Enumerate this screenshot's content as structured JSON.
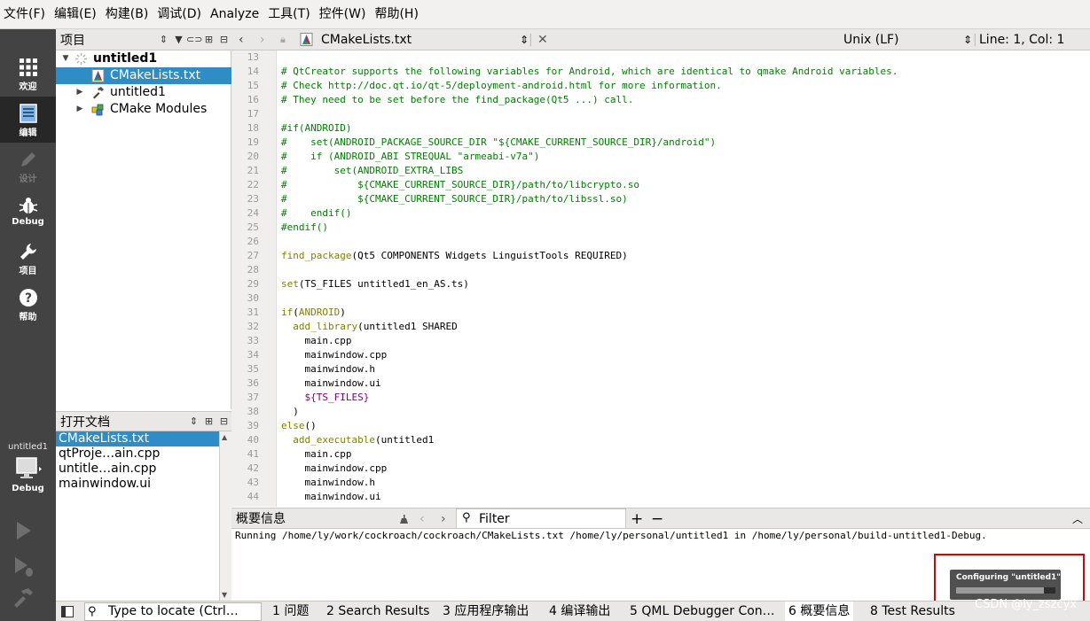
{
  "menu": [
    "文件(F)",
    "编辑(E)",
    "构建(B)",
    "调试(D)",
    "Analyze",
    "工具(T)",
    "控件(W)",
    "帮助(H)"
  ],
  "modes": [
    {
      "label": "欢迎",
      "icon": "grid-icon"
    },
    {
      "label": "编辑",
      "icon": "document-icon"
    },
    {
      "label": "设计",
      "icon": "pencil-icon"
    },
    {
      "label": "Debug",
      "icon": "bug-icon"
    },
    {
      "label": "项目",
      "icon": "wrench-icon"
    },
    {
      "label": "帮助",
      "icon": "help-icon"
    }
  ],
  "kit": {
    "name": "untitled1",
    "label": "Debug"
  },
  "project_panel": {
    "title": "项目",
    "tree": [
      {
        "label": "untitled1",
        "level": 0,
        "bold": true
      },
      {
        "label": "CMakeLists.txt",
        "level": 1,
        "selected": true
      },
      {
        "label": "untitled1",
        "level": 1
      },
      {
        "label": "CMake Modules",
        "level": 1
      }
    ]
  },
  "open_docs": {
    "title": "打开文档",
    "items": [
      "CMakeLists.txt",
      "qtProje…ain.cpp",
      "untitle…ain.cpp",
      "mainwindow.ui"
    ]
  },
  "editor_toolbar": {
    "file": "CMakeLists.txt",
    "line_ending": "Unix (LF)",
    "position": "Line: 1, Col: 1"
  },
  "code_lines": [
    {
      "n": "13",
      "t": ""
    },
    {
      "n": "14",
      "t": "# QtCreator supports the following variables for Android, which are identical to qmake Android variables."
    },
    {
      "n": "15",
      "t": "# Check http://doc.qt.io/qt-5/deployment-android.html for more information."
    },
    {
      "n": "16",
      "t": "# They need to be set before the find_package(Qt5 ...) call."
    },
    {
      "n": "17",
      "t": ""
    },
    {
      "n": "18",
      "t": "#if(ANDROID)"
    },
    {
      "n": "19",
      "t": "#    set(ANDROID_PACKAGE_SOURCE_DIR \"${CMAKE_CURRENT_SOURCE_DIR}/android\")"
    },
    {
      "n": "20",
      "t": "#    if (ANDROID_ABI STREQUAL \"armeabi-v7a\")"
    },
    {
      "n": "21",
      "t": "#        set(ANDROID_EXTRA_LIBS"
    },
    {
      "n": "22",
      "t": "#            ${CMAKE_CURRENT_SOURCE_DIR}/path/to/libcrypto.so"
    },
    {
      "n": "23",
      "t": "#            ${CMAKE_CURRENT_SOURCE_DIR}/path/to/libssl.so)"
    },
    {
      "n": "24",
      "t": "#    endif()"
    },
    {
      "n": "25",
      "t": "#endif()"
    },
    {
      "n": "26",
      "t": ""
    },
    {
      "n": "27",
      "t": "find_package(Qt5 COMPONENTS Widgets LinguistTools REQUIRED)"
    },
    {
      "n": "28",
      "t": ""
    },
    {
      "n": "29",
      "t": "set(TS_FILES untitled1_en_AS.ts)"
    },
    {
      "n": "30",
      "t": ""
    },
    {
      "n": "31",
      "t": "if(ANDROID)"
    },
    {
      "n": "32",
      "t": "  add_library(untitled1 SHARED"
    },
    {
      "n": "33",
      "t": "    main.cpp"
    },
    {
      "n": "34",
      "t": "    mainwindow.cpp"
    },
    {
      "n": "35",
      "t": "    mainwindow.h"
    },
    {
      "n": "36",
      "t": "    mainwindow.ui"
    },
    {
      "n": "37",
      "t": "    ${TS_FILES}"
    },
    {
      "n": "38",
      "t": "  )"
    },
    {
      "n": "39",
      "t": "else()"
    },
    {
      "n": "40",
      "t": "  add_executable(untitled1"
    },
    {
      "n": "41",
      "t": "    main.cpp"
    },
    {
      "n": "42",
      "t": "    mainwindow.cpp"
    },
    {
      "n": "43",
      "t": "    mainwindow.h"
    },
    {
      "n": "44",
      "t": "    mainwindow.ui"
    }
  ],
  "output_panel": {
    "title": "概要信息",
    "filter": "Filter",
    "text": "Running /home/ly/work/cockroach/cockroach/CMakeLists.txt /home/ly/personal/untitled1 in /home/ly/personal/build-untitled1-Debug."
  },
  "progress": {
    "label": "Configuring \"untitled1\"",
    "fraction": 0.88
  },
  "statusbar": {
    "locator_placeholder": "Type to locate (Ctrl…",
    "tabs": [
      {
        "num": "1",
        "label": "问题"
      },
      {
        "num": "2",
        "label": "Search Results"
      },
      {
        "num": "3",
        "label": "应用程序输出"
      },
      {
        "num": "4",
        "label": "编译输出"
      },
      {
        "num": "5",
        "label": "QML Debugger Con…"
      },
      {
        "num": "6",
        "label": "概要信息"
      },
      {
        "num": "8",
        "label": "Test Results"
      }
    ]
  },
  "watermark": "CSDN @ly_zszcyx",
  "colors": {
    "selection": "#308cc6",
    "modebar": "#434343",
    "comment": "#008000",
    "function": "#808000",
    "variable": "#800080",
    "highlight_frame": "#e00000"
  }
}
